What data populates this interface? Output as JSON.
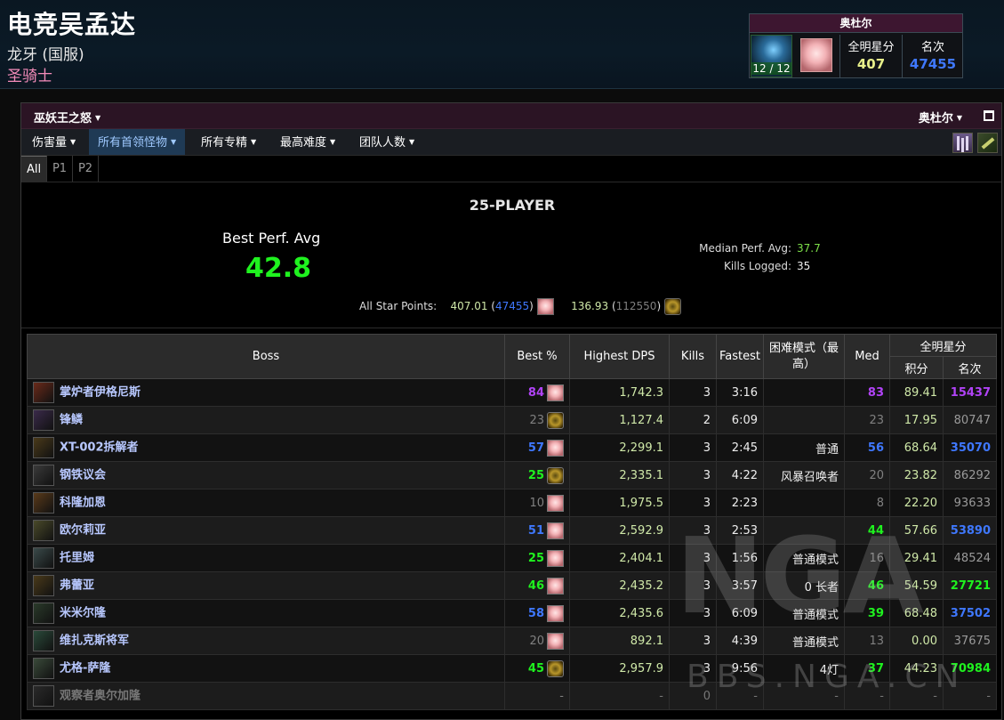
{
  "character": {
    "name": "电竞吴孟达",
    "realm": "龙牙 (国服)",
    "class": "圣骑士"
  },
  "stat_box": {
    "title": "奥杜尔",
    "progress": "12 / 12",
    "allstar_label": "全明星分",
    "allstar_value": "407",
    "rank_label": "名次",
    "rank_value": "47455"
  },
  "panel": {
    "expansion": "巫妖王之怒",
    "zone": "奥杜尔",
    "filters": [
      "伤害量",
      "所有首领怪物",
      "所有专精",
      "最高难度",
      "团队人数"
    ],
    "active_filter_index": 1,
    "phase_tabs": [
      "All",
      "P1",
      "P2"
    ]
  },
  "summary": {
    "title": "25-PLAYER",
    "best_perf_label": "Best Perf. Avg",
    "best_perf_value": "42.8",
    "median_label": "Median Perf. Avg:",
    "median_value": "37.7",
    "kills_label": "Kills Logged:",
    "kills_value": "35",
    "all_star_label": "All Star Points:",
    "asp1_points": "407.01",
    "asp1_rank": "47455",
    "asp2_points": "136.93",
    "asp2_rank": "112550"
  },
  "table": {
    "headers": {
      "boss": "Boss",
      "best": "Best %",
      "dps": "Highest DPS",
      "kills": "Kills",
      "fastest": "Fastest",
      "difficulty": "困难模式（最高）",
      "med": "Med",
      "allstar": "全明星分",
      "points": "积分",
      "rank": "名次"
    },
    "rows": [
      {
        "boss": "掌炉者伊格尼斯",
        "best": "84",
        "best_color": "purple",
        "icon": "pal",
        "dps": "1,742.3",
        "kills": "3",
        "fastest": "3:16",
        "difficulty": "",
        "med": "83",
        "med_color": "purple",
        "points": "89.41",
        "rank": "15437",
        "rank_color": "purple"
      },
      {
        "boss": "锋鳞",
        "best": "23",
        "best_color": "gray",
        "icon": "gold",
        "dps": "1,127.4",
        "kills": "2",
        "fastest": "6:09",
        "difficulty": "",
        "med": "23",
        "med_color": "gray",
        "points": "17.95",
        "rank": "80747",
        "rank_color": "gray"
      },
      {
        "boss": "XT-002拆解者",
        "best": "57",
        "best_color": "blue",
        "icon": "pal",
        "dps": "2,299.1",
        "kills": "3",
        "fastest": "2:45",
        "difficulty": "普通",
        "med": "56",
        "med_color": "blue",
        "points": "68.64",
        "rank": "35070",
        "rank_color": "blue"
      },
      {
        "boss": "钢铁议会",
        "best": "25",
        "best_color": "green",
        "icon": "gold",
        "dps": "2,335.1",
        "kills": "3",
        "fastest": "4:22",
        "difficulty": "风暴召唤者",
        "med": "20",
        "med_color": "gray",
        "points": "23.82",
        "rank": "86292",
        "rank_color": "gray"
      },
      {
        "boss": "科隆加恩",
        "best": "10",
        "best_color": "gray",
        "icon": "pal",
        "dps": "1,975.5",
        "kills": "3",
        "fastest": "2:23",
        "difficulty": "",
        "med": "8",
        "med_color": "gray",
        "points": "22.20",
        "rank": "93633",
        "rank_color": "gray"
      },
      {
        "boss": "欧尔莉亚",
        "best": "51",
        "best_color": "blue",
        "icon": "pal",
        "dps": "2,592.9",
        "kills": "3",
        "fastest": "2:53",
        "difficulty": "",
        "med": "44",
        "med_color": "green",
        "points": "57.66",
        "rank": "53890",
        "rank_color": "blue"
      },
      {
        "boss": "托里姆",
        "best": "25",
        "best_color": "green",
        "icon": "pal",
        "dps": "2,404.1",
        "kills": "3",
        "fastest": "1:56",
        "difficulty": "普通模式",
        "med": "16",
        "med_color": "gray",
        "points": "29.41",
        "rank": "48524",
        "rank_color": "gray"
      },
      {
        "boss": "弗蕾亚",
        "best": "46",
        "best_color": "green",
        "icon": "pal",
        "dps": "2,435.2",
        "kills": "3",
        "fastest": "3:57",
        "difficulty": "0 长者",
        "med": "46",
        "med_color": "green",
        "points": "54.59",
        "rank": "27721",
        "rank_color": "green"
      },
      {
        "boss": "米米尔隆",
        "best": "58",
        "best_color": "blue",
        "icon": "pal",
        "dps": "2,435.6",
        "kills": "3",
        "fastest": "6:09",
        "difficulty": "普通模式",
        "med": "39",
        "med_color": "green",
        "points": "68.48",
        "rank": "37502",
        "rank_color": "blue"
      },
      {
        "boss": "维扎克斯将军",
        "best": "20",
        "best_color": "gray",
        "icon": "pal",
        "dps": "892.1",
        "kills": "3",
        "fastest": "4:39",
        "difficulty": "普通模式",
        "med": "13",
        "med_color": "gray",
        "points": "0.00",
        "rank": "37675",
        "rank_color": "gray"
      },
      {
        "boss": "尤格-萨隆",
        "best": "45",
        "best_color": "green",
        "icon": "gold",
        "dps": "2,957.9",
        "kills": "3",
        "fastest": "9:56",
        "difficulty": "4灯",
        "med": "37",
        "med_color": "green",
        "points": "44.23",
        "rank": "70984",
        "rank_color": "green"
      },
      {
        "boss": "观察者奥尔加隆",
        "best": "-",
        "best_color": "dim",
        "icon": "",
        "dps": "-",
        "kills": "0",
        "fastest": "-",
        "difficulty": "-",
        "med": "-",
        "med_color": "dim",
        "points": "-",
        "rank": "-",
        "rank_color": "dim"
      }
    ]
  },
  "watermark": {
    "logo": "NGA",
    "url": "BBS.NGA.CN"
  },
  "colors": {
    "purple": "#b143f7",
    "blue": "#3f78ff",
    "green": "#1ff21f",
    "gray": "#808080",
    "class_paladin": "#f48cba",
    "header_bg": "#0b1a26",
    "panel_title_bg": "#2b1424"
  },
  "icons": {
    "maximize": "maximize-icon",
    "class_icon": "paladin-icon",
    "filter_icons": [
      "raid-party-icon",
      "key-icon"
    ]
  }
}
